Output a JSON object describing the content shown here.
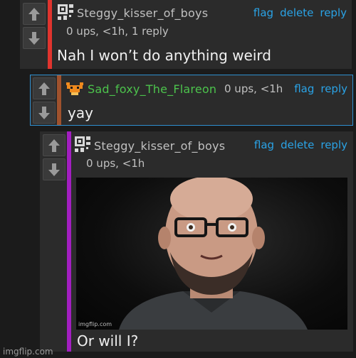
{
  "comments": [
    {
      "username": "Steggy_kisser_of_boys",
      "meta": "0 ups, <1h, 1 reply",
      "text": "Nah I won’t do anything weird",
      "actions": [
        "flag",
        "delete",
        "reply"
      ],
      "accent_color": "#e0342e",
      "avatar_icon": "qr-avatar-icon"
    },
    {
      "username": "Sad_foxy_The_Flareon",
      "meta": "0 ups, <1h",
      "text": "yay",
      "actions": [
        "flag",
        "reply"
      ],
      "accent_color": "#a0522d",
      "username_color": "#4cc34c",
      "avatar_icon": "flareon-avatar-icon"
    },
    {
      "username": "Steggy_kisser_of_boys",
      "meta": "0 ups, <1h",
      "meme_watermark": "imgflip.com",
      "meme_caption": "Or will I?",
      "actions": [
        "flag",
        "delete",
        "reply"
      ],
      "accent_color": "#a21ec0",
      "avatar_icon": "qr-avatar-icon"
    }
  ],
  "footer_watermark": "imgflip.com"
}
